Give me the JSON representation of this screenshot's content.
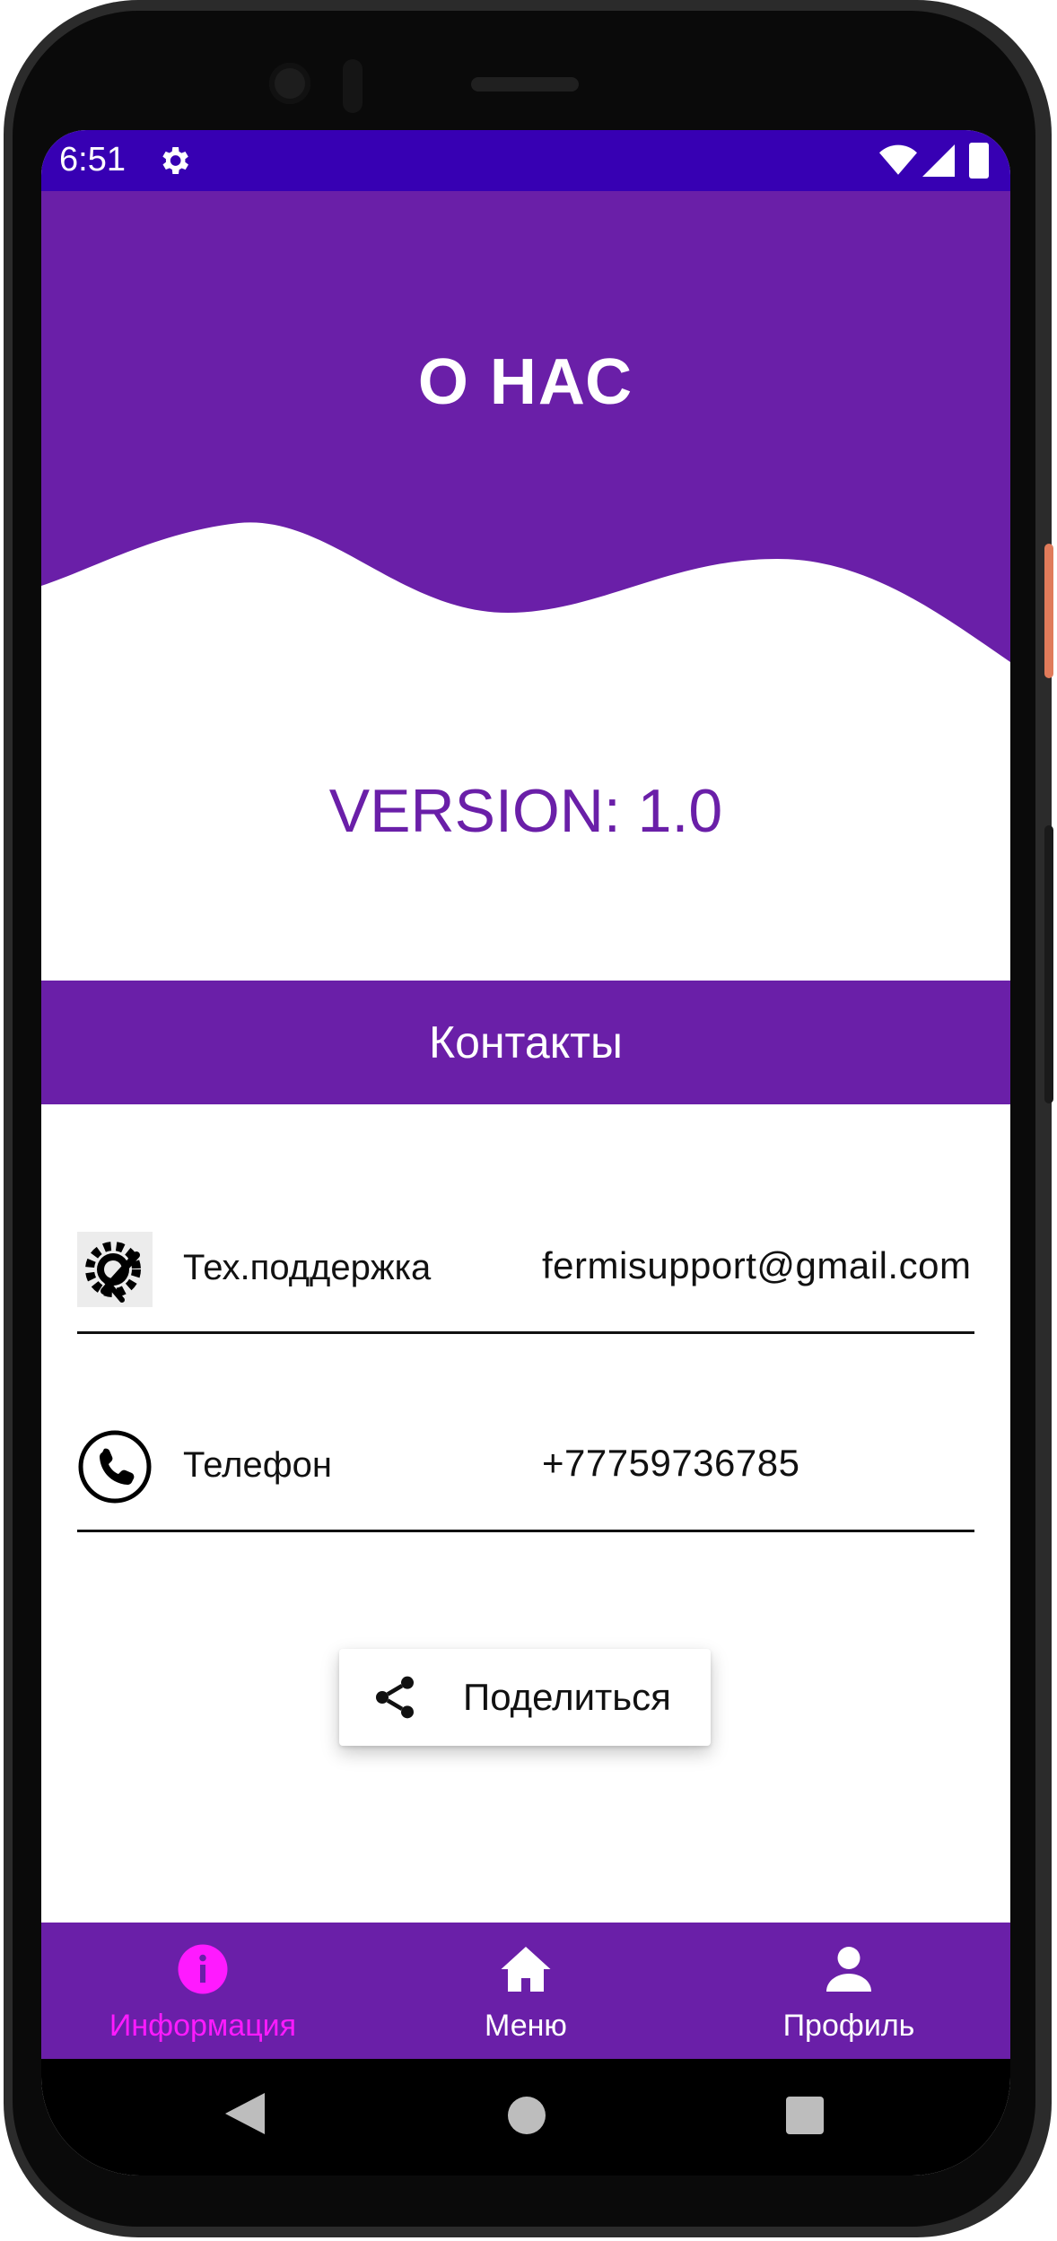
{
  "status_bar": {
    "time": "6:51"
  },
  "header": {
    "title": "О НАС"
  },
  "version_text": "VERSION: 1.0",
  "contacts": {
    "section_title": "Контакты",
    "items": [
      {
        "icon": "support-gear-wrench-icon",
        "label": "Тех.поддержка",
        "value": "fermisupport@gmail.com"
      },
      {
        "icon": "phone-icon",
        "label": "Телефон",
        "value": "+77759736785"
      }
    ]
  },
  "share_button": {
    "icon": "share-icon",
    "label": "Поделиться"
  },
  "bottom_nav": {
    "items": [
      {
        "icon": "info-icon",
        "label": "Информация",
        "active": true
      },
      {
        "icon": "home-icon",
        "label": "Меню",
        "active": false
      },
      {
        "icon": "person-icon",
        "label": "Профиль",
        "active": false
      }
    ]
  },
  "colors": {
    "primary": "#6a1fa8",
    "status_bar": "#3700b3",
    "active_nav": "#ff1aff"
  }
}
